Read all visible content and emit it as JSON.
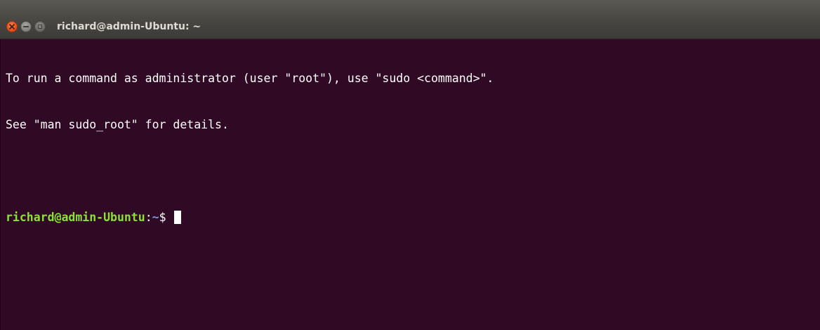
{
  "window": {
    "title": "richard@admin-Ubuntu: ~",
    "background_color": "#300a24",
    "titlebar_color": "#3c3b37"
  },
  "controls": {
    "close_icon": "close-icon",
    "minimize_icon": "minimize-icon",
    "maximize_icon": "maximize-icon"
  },
  "terminal": {
    "output": [
      "To run a command as administrator (user \"root\"), use \"sudo <command>\".",
      "See \"man sudo_root\" for details."
    ],
    "prompt": {
      "user_host": "richard@admin-Ubuntu",
      "separator": ":",
      "path": "~",
      "symbol": "$ "
    },
    "colors": {
      "text": "#ffffff",
      "user_host": "#8ae234",
      "path": "#729fcf"
    }
  }
}
